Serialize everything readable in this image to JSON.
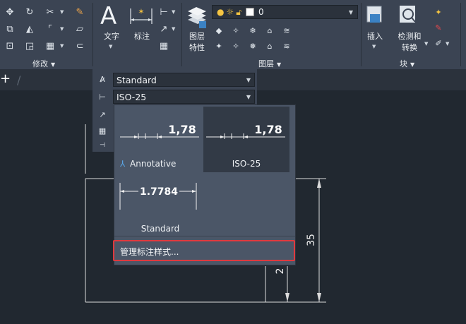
{
  "ribbon": {
    "modify": {
      "label": "修改"
    },
    "text_tool": {
      "label": "文字",
      "icon": "A"
    },
    "dimension_tool": {
      "label": "标注"
    },
    "layer_props": {
      "label_line1": "图层",
      "label_line2": "特性"
    },
    "layer_combo": {
      "current": "0"
    },
    "layers": {
      "label": "图层"
    },
    "insert": {
      "label": "插入"
    },
    "check_convert": {
      "label_line1": "检测和",
      "label_line2": "转换"
    },
    "block": {
      "label": "块"
    }
  },
  "tabs": {
    "new_tab_icon": "+",
    "separator": "/"
  },
  "annotation_panel": {
    "text_style": "Standard",
    "dim_style": "ISO-25"
  },
  "style_gallery": {
    "items": [
      {
        "name": "Annotative",
        "preview_value": "1,78",
        "annotative_marker": "⅄",
        "selected": false
      },
      {
        "name": "ISO-25",
        "preview_value": "1,78",
        "selected": true
      },
      {
        "name": "Standard",
        "preview_value": "1.7784",
        "selected": false
      }
    ],
    "manage_label": "管理标注样式..."
  },
  "drawing": {
    "dimension_vertical": "35",
    "dimension_small": "2"
  },
  "colors": {
    "highlight": "#e0393e",
    "ribbon_bg": "#3b4453",
    "canvas_bg": "#212830"
  }
}
